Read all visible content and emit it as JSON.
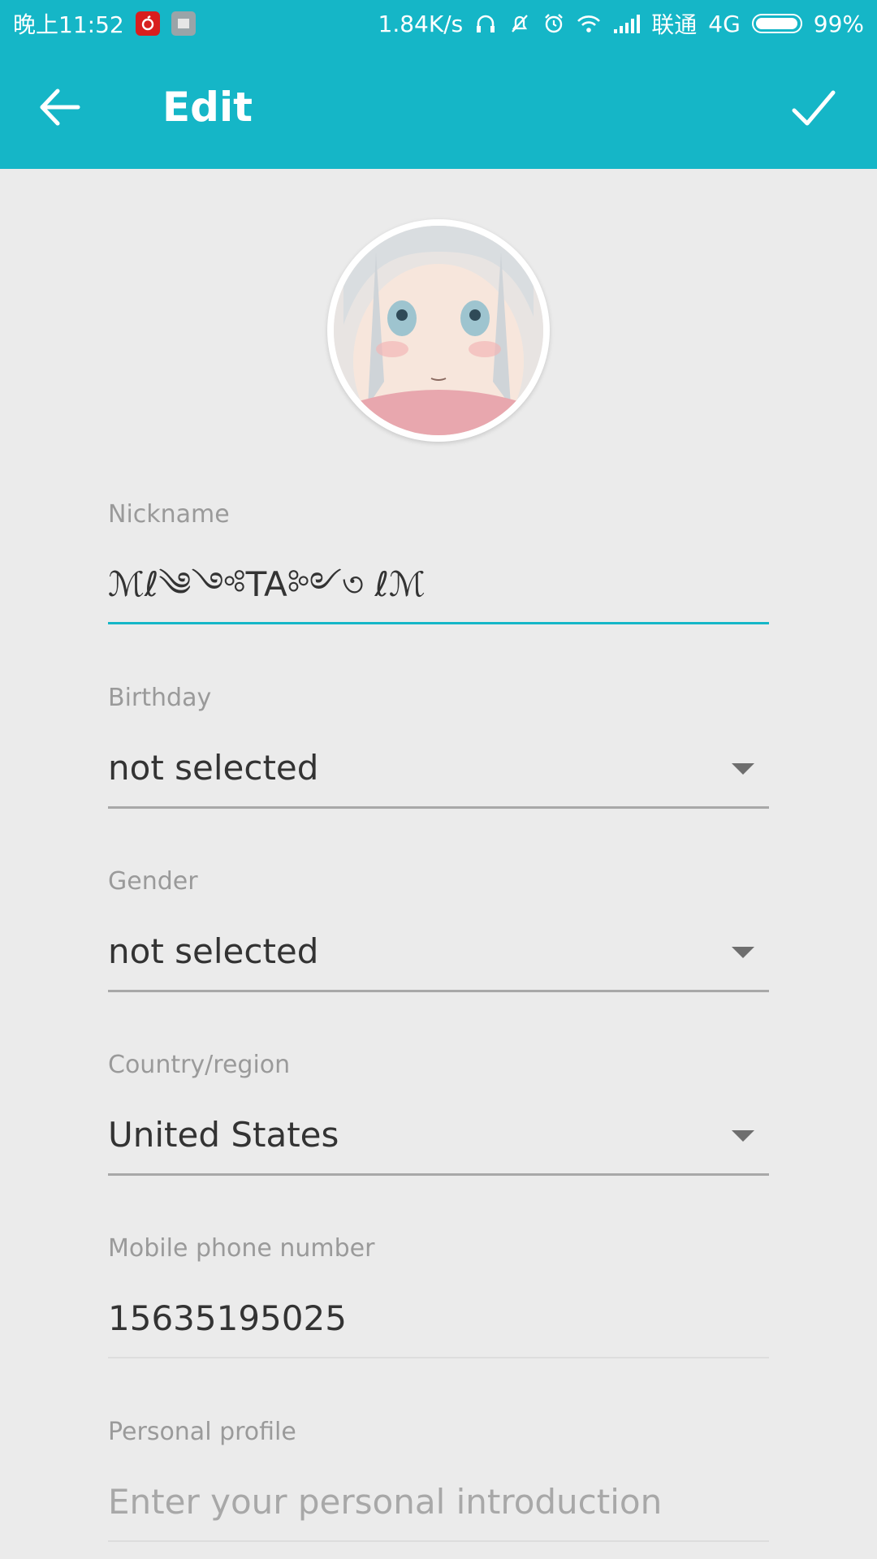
{
  "status_bar": {
    "time": "晚上11:52",
    "network_speed": "1.84K/s",
    "carrier": "联通",
    "network_type": "4G",
    "battery": "99%",
    "icons": [
      "netease-music-icon",
      "notification-icon",
      "headphone-icon",
      "silent-icon",
      "alarm-icon",
      "wifi-icon",
      "signal-icon",
      "battery-icon"
    ]
  },
  "app_bar": {
    "title": "Edit",
    "back_icon": "arrow-back-icon",
    "confirm_icon": "check-icon"
  },
  "colors": {
    "primary": "#15b6c7",
    "background": "#ebebeb",
    "label": "#9a9a9a",
    "value": "#333333"
  },
  "form": {
    "nickname": {
      "label": "Nickname",
      "value": "ℳℓ༄༺TA༻৩ ℓℳ"
    },
    "birthday": {
      "label": "Birthday",
      "value": "not selected"
    },
    "gender": {
      "label": "Gender",
      "value": "not selected"
    },
    "country": {
      "label": "Country/region",
      "value": "United States"
    },
    "phone": {
      "label": "Mobile phone number",
      "value": "15635195025"
    },
    "profile": {
      "label": "Personal profile",
      "placeholder": "Enter your personal introduction"
    }
  }
}
